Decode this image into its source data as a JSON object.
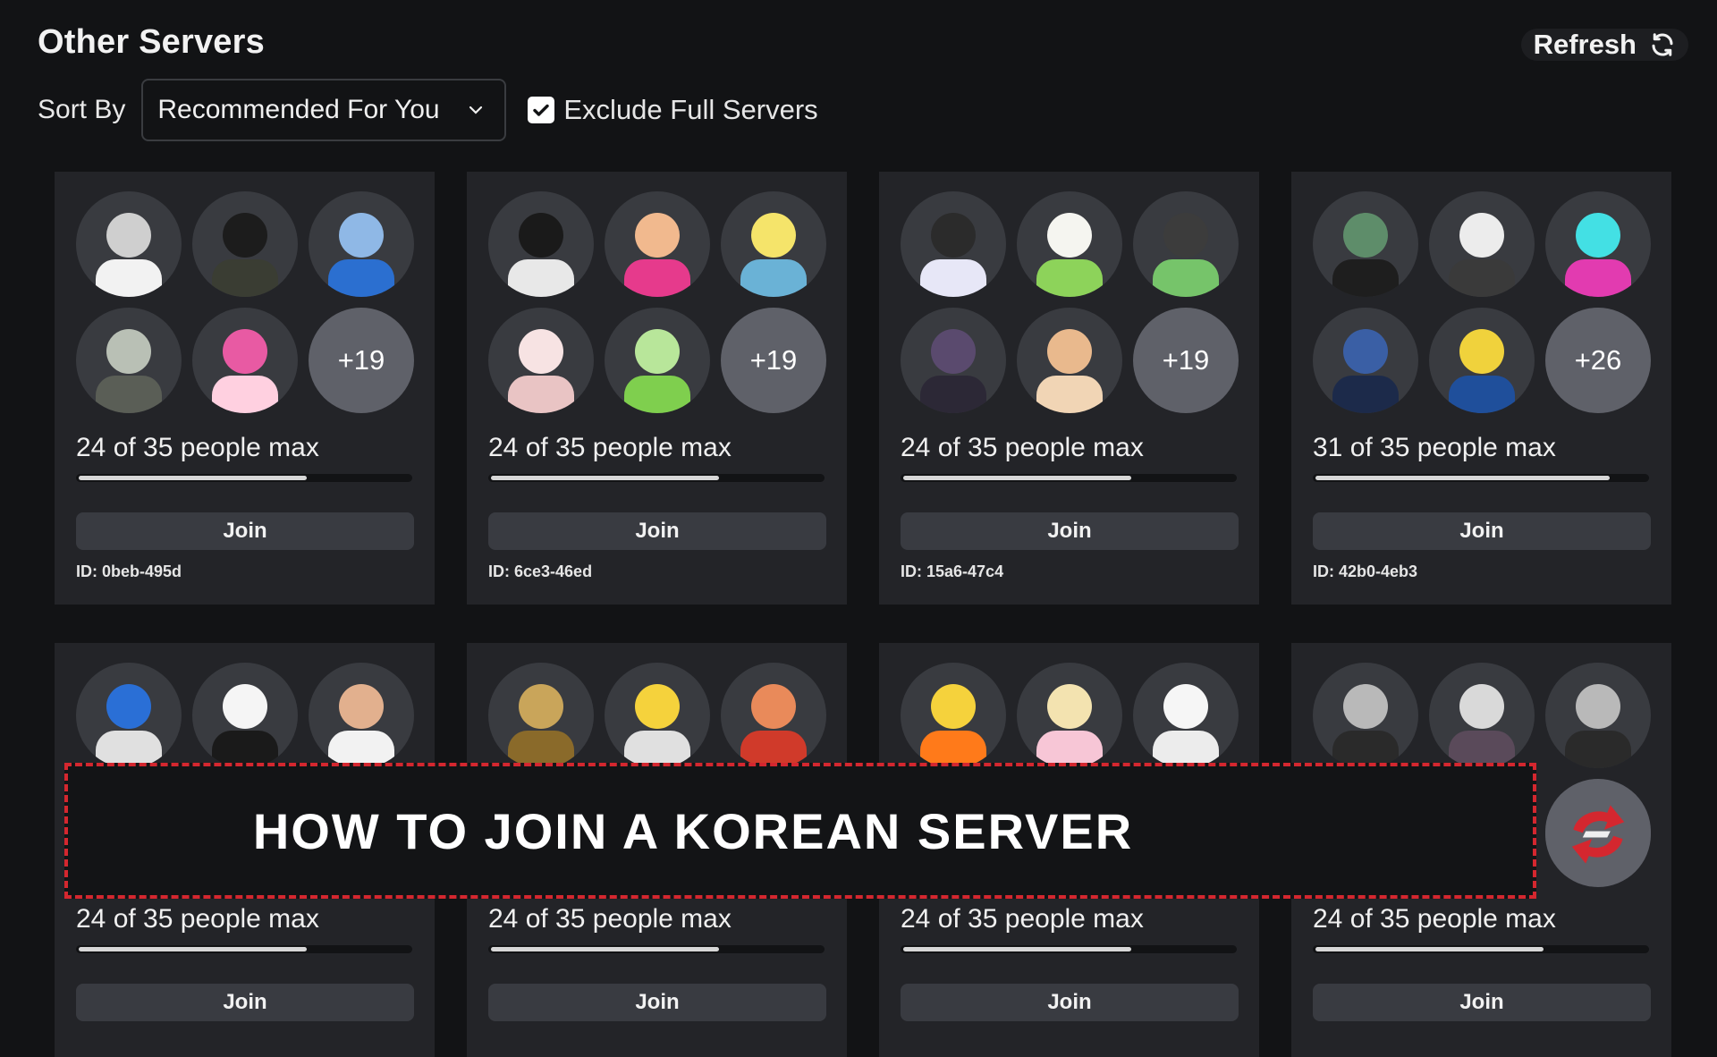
{
  "header": {
    "title": "Other Servers",
    "refresh_label": "Refresh"
  },
  "controls": {
    "sort_label": "Sort By",
    "sort_value": "Recommended For You",
    "exclude_label": "Exclude Full Servers",
    "exclude_checked": true
  },
  "servers": [
    {
      "more": "+19",
      "count": "24 of 35 people max",
      "fill": 0.69,
      "join": "Join",
      "id": "ID: 0beb-495d",
      "avatars": [
        [
          "#cfcfcf",
          "#f2f2f2"
        ],
        [
          "#1c1c1c",
          "#3a3d33"
        ],
        [
          "#8fb8e6",
          "#2b6fd0"
        ],
        [
          "#b9c0b5",
          "#5a5e56"
        ],
        [
          "#e85aa3",
          "#ffd0e0"
        ]
      ]
    },
    {
      "more": "+19",
      "count": "24 of 35 people max",
      "fill": 0.69,
      "join": "Join",
      "id": "ID: 6ce3-46ed",
      "avatars": [
        [
          "#1a1a1a",
          "#e8e8e8"
        ],
        [
          "#f1b98e",
          "#e63a8c"
        ],
        [
          "#f5e46a",
          "#6ab2d6"
        ],
        [
          "#f7e3e3",
          "#e9c4c4"
        ],
        [
          "#b8e69a",
          "#7fcf4e"
        ]
      ]
    },
    {
      "more": "+19",
      "count": "24 of 35 people max",
      "fill": 0.69,
      "join": "Join",
      "id": "ID: 15a6-47c4",
      "avatars": [
        [
          "#2b2b2b",
          "#e7e7f7"
        ],
        [
          "#f5f5f0",
          "#8dd35a"
        ],
        [
          "#3c3c3c",
          "#76c46a"
        ],
        [
          "#5a4a6e",
          "#2c2836"
        ],
        [
          "#e9b98d",
          "#f1d5b5"
        ]
      ]
    },
    {
      "more": "+26",
      "count": "31 of 35 people max",
      "fill": 0.89,
      "join": "Join",
      "id": "ID: 42b0-4eb3",
      "avatars": [
        [
          "#5e8d6a",
          "#1e1e1e"
        ],
        [
          "#ececec",
          "#3a3a3a"
        ],
        [
          "#43e0e4",
          "#e23bb0"
        ],
        [
          "#3a5fa5",
          "#1c2a4a"
        ],
        [
          "#f0d23c",
          "#1f4f9b"
        ]
      ]
    },
    {
      "more": "",
      "count": "24 of 35 people max",
      "fill": 0.69,
      "join": "Join",
      "id": "",
      "avatars": [
        [
          "#2a6fd6",
          "#e0e0e0"
        ],
        [
          "#f5f5f5",
          "#1a1a1a"
        ],
        [
          "#e2b08e",
          "#f2f2f2"
        ],
        [
          "#2e3a2c",
          "#1a2219"
        ],
        [
          "#3a3a3a",
          "#2a2a2a"
        ]
      ]
    },
    {
      "more": "",
      "count": "24 of 35 people max",
      "fill": 0.69,
      "join": "Join",
      "id": "",
      "avatars": [
        [
          "#c9a55a",
          "#8a6a2a"
        ],
        [
          "#f5d23c",
          "#e0e0e0"
        ],
        [
          "#e98a5a",
          "#d03a2a"
        ],
        [
          "#2e2e2e",
          "#222"
        ],
        [
          "#2e2e2e",
          "#222"
        ]
      ]
    },
    {
      "more": "",
      "count": "24 of 35 people max",
      "fill": 0.69,
      "join": "Join",
      "id": "",
      "avatars": [
        [
          "#f5d23c",
          "#ff7a1a"
        ],
        [
          "#f3e3b0",
          "#f7c6d6"
        ],
        [
          "#f6f6f6",
          "#ececec"
        ],
        [
          "#2e2e2e",
          "#222"
        ],
        [
          "#2e2e2e",
          "#222"
        ]
      ]
    },
    {
      "more": "",
      "count": "24 of 35 people max",
      "fill": 0.69,
      "join": "Join",
      "id": "",
      "avatars": [
        [
          "#b9b9b9",
          "#2a2a2a"
        ],
        [
          "#d9d9d9",
          "#5a4a5a"
        ],
        [
          "#b9b9b9",
          "#2a2a2a"
        ],
        [
          "#2e2e2e",
          "#222"
        ],
        [
          "#2e2e2e",
          "#222"
        ]
      ]
    }
  ],
  "banner": {
    "text": "HOW TO JOIN A KOREAN SERVER"
  },
  "colors": {
    "background": "#121315",
    "card": "#232428",
    "accent_red": "#d4272f"
  }
}
